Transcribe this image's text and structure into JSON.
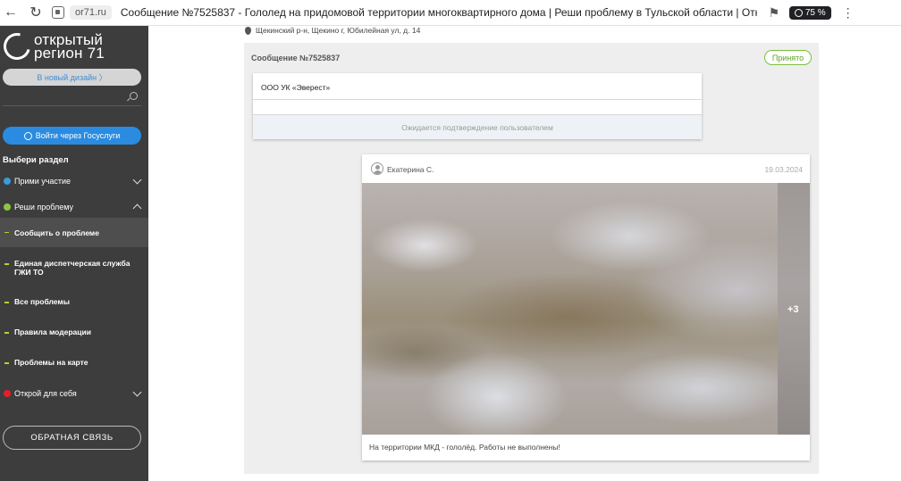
{
  "browser": {
    "domain": "or71.ru",
    "tab_title": "Сообщение №7525837 - Гололед на придомовой территории многоквартирного дома | Реши проблему в Тульской области | Открытый регио...",
    "zoom": "75 %"
  },
  "sidebar": {
    "logo_line1": "открытый",
    "logo_line2": "регион  71",
    "new_design": "В новый дизайн  〉",
    "gosuslugi": "Войти через Госуслуги",
    "section_title": "Выбери раздел",
    "items": [
      {
        "label": "Прими участие",
        "dot_color": "#3d9ad8"
      },
      {
        "label": "Реши проблему",
        "dot_color": "#8dc63f"
      },
      {
        "label": "Открой для себя",
        "dot_color": "#e3202a"
      }
    ],
    "subitems": [
      {
        "label": "Сообщить о проблеме"
      },
      {
        "label": "Единая диспетчерская служба ГЖИ ТО"
      },
      {
        "label": "Все проблемы"
      },
      {
        "label": "Правила модерации"
      },
      {
        "label": "Проблемы на карте"
      }
    ],
    "feedback": "ОБРАТНАЯ СВЯЗЬ"
  },
  "main": {
    "address": "Щекинский р-н, Щекино г, Юбилейная ул, д. 14",
    "message_number": "Сообщение №7525837",
    "status": "Принято",
    "org_name": "ООО УК «Эверест»",
    "waiting": "Ожидается подтверждение пользователем",
    "comment": {
      "author": "Екатерина С.",
      "date": "19.03.2024",
      "more_photos": "+3",
      "text": "На территории МКД - гололёд. Работы не выполнены!"
    }
  }
}
